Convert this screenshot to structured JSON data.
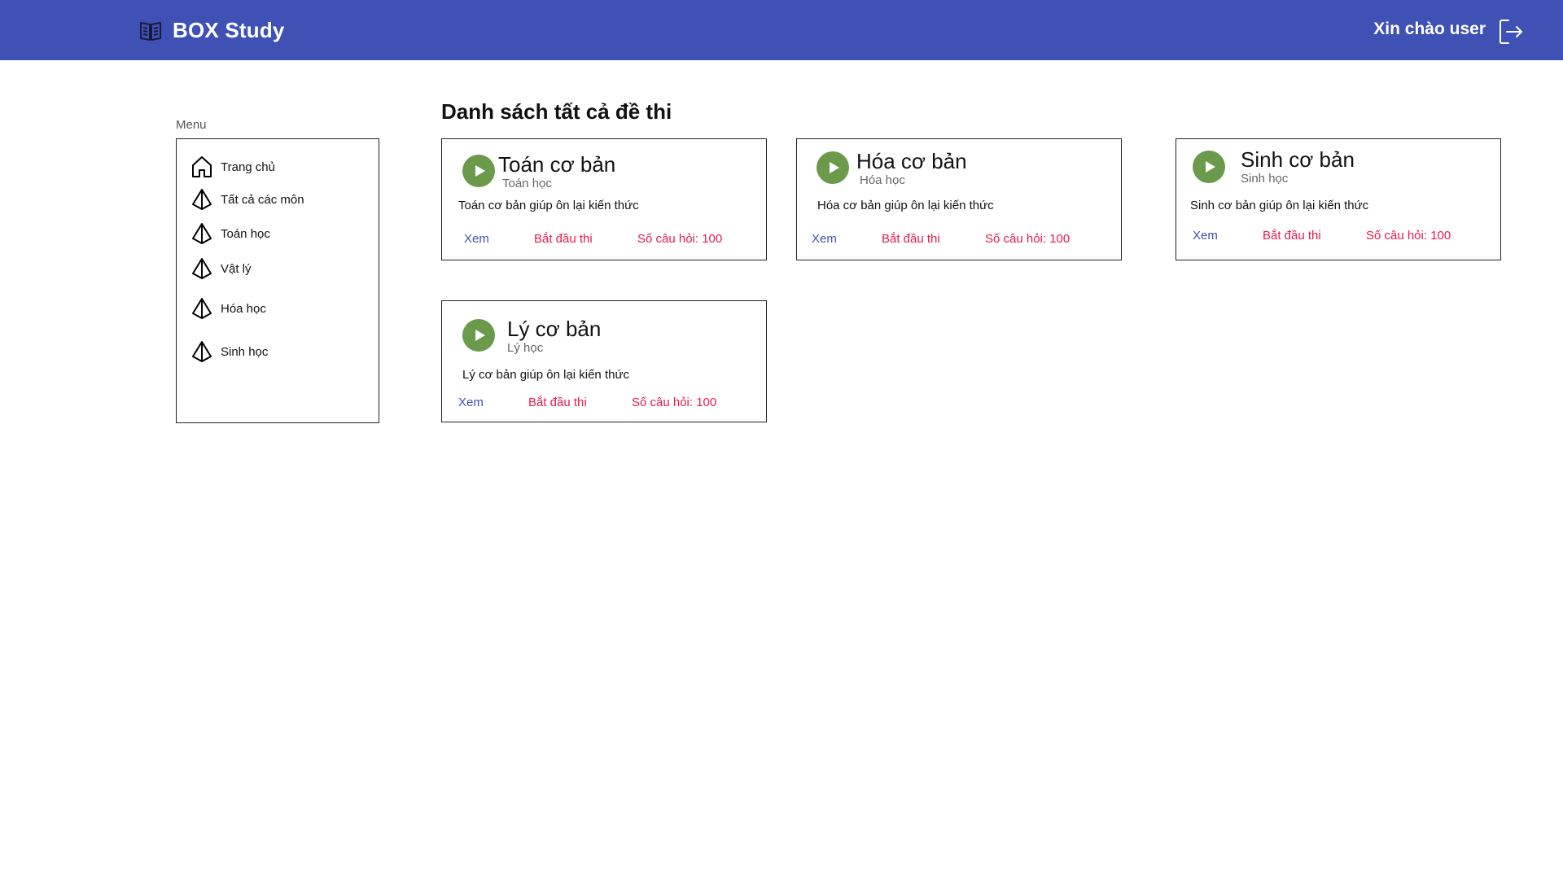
{
  "header": {
    "brand": "BOX Study",
    "greeting": "Xin chào user",
    "colors": {
      "bar": "#3f51b5"
    },
    "icons": {
      "brand": "book-icon",
      "logout": "logout-icon"
    }
  },
  "menu": {
    "caption": "Menu",
    "items": [
      {
        "label": "Trang chủ",
        "icon": "home-icon"
      },
      {
        "label": "Tất cả các môn",
        "icon": "pyramid-icon"
      },
      {
        "label": "Toán học",
        "icon": "pyramid-icon"
      },
      {
        "label": "Vật lý",
        "icon": "pyramid-icon"
      },
      {
        "label": "Hóa học",
        "icon": "pyramid-icon"
      },
      {
        "label": "Sinh học",
        "icon": "pyramid-icon"
      }
    ]
  },
  "main": {
    "title": "Danh sách tất cả đề thi",
    "exams": [
      {
        "title": "Toán cơ bản",
        "subject": "Toán học",
        "description": "Toán cơ bản giúp ôn lại kiến thức",
        "view_label": "Xem",
        "start_label": "Bắt đầu thi",
        "count_label": "Số câu hỏi: 100"
      },
      {
        "title": "Hóa cơ bản",
        "subject": "Hóa học",
        "description": "Hóa cơ bản giúp ôn lại kiến thức",
        "view_label": "Xem",
        "start_label": "Bắt đầu thi",
        "count_label": "Số câu hỏi: 100"
      },
      {
        "title": "Sinh cơ bản",
        "subject": "Sinh học",
        "description": "Sinh cơ bản giúp ôn lại kiến thức",
        "view_label": "Xem",
        "start_label": "Bắt đầu thi",
        "count_label": "Số câu hỏi: 100"
      },
      {
        "title": "Lý cơ bản",
        "subject": "Lý học",
        "description": "Lý cơ bản giúp ôn lại kiến thức",
        "view_label": "Xem",
        "start_label": "Bắt đầu thi",
        "count_label": "Số câu hỏi: 100"
      }
    ],
    "colors": {
      "play": "#6a9a4a",
      "view": "#3f51b5",
      "start": "#e8194a",
      "count": "#e8194a"
    }
  }
}
